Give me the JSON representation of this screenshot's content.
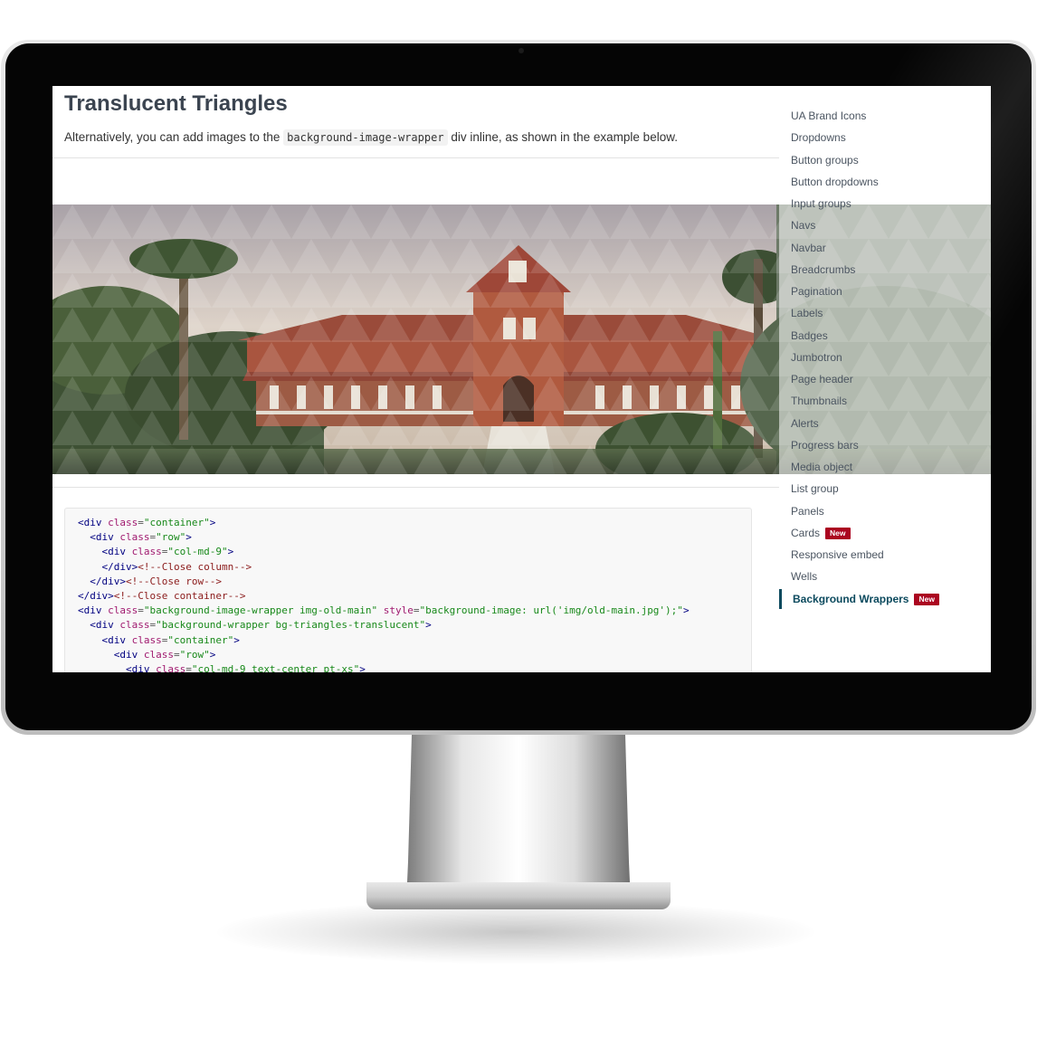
{
  "page": {
    "title": "Translucent Triangles",
    "intro_before": "Alternatively, you can add images to the",
    "intro_code": "background-image-wrapper",
    "intro_after": "div inline, as shown in the example below."
  },
  "code_lines": [
    [
      [
        "tag",
        "<div "
      ],
      [
        "attr",
        "class"
      ],
      [
        "eq",
        "="
      ],
      [
        "str",
        "\"container\""
      ],
      [
        "tag",
        ">"
      ]
    ],
    [
      [
        "tag",
        "  <div "
      ],
      [
        "attr",
        "class"
      ],
      [
        "eq",
        "="
      ],
      [
        "str",
        "\"row\""
      ],
      [
        "tag",
        ">"
      ]
    ],
    [
      [
        "tag",
        "    <div "
      ],
      [
        "attr",
        "class"
      ],
      [
        "eq",
        "="
      ],
      [
        "str",
        "\"col-md-9\""
      ],
      [
        "tag",
        ">"
      ]
    ],
    [
      [
        "tag",
        "    </div>"
      ],
      [
        "com",
        "<!--Close column-->"
      ]
    ],
    [
      [
        "tag",
        "  </div>"
      ],
      [
        "com",
        "<!--Close row-->"
      ]
    ],
    [
      [
        "tag",
        "</div>"
      ],
      [
        "com",
        "<!--Close container-->"
      ]
    ],
    [
      [
        "tag",
        "<div "
      ],
      [
        "attr",
        "class"
      ],
      [
        "eq",
        "="
      ],
      [
        "str",
        "\"background-image-wrapper img-old-main\""
      ],
      [
        "tag",
        " "
      ],
      [
        "attr",
        "style"
      ],
      [
        "eq",
        "="
      ],
      [
        "str",
        "\"background-image: url('img/old-main.jpg');\""
      ],
      [
        "tag",
        ">"
      ]
    ],
    [
      [
        "tag",
        "  <div "
      ],
      [
        "attr",
        "class"
      ],
      [
        "eq",
        "="
      ],
      [
        "str",
        "\"background-wrapper bg-triangles-translucent\""
      ],
      [
        "tag",
        ">"
      ]
    ],
    [
      [
        "tag",
        "    <div "
      ],
      [
        "attr",
        "class"
      ],
      [
        "eq",
        "="
      ],
      [
        "str",
        "\"container\""
      ],
      [
        "tag",
        ">"
      ]
    ],
    [
      [
        "tag",
        "      <div "
      ],
      [
        "attr",
        "class"
      ],
      [
        "eq",
        "="
      ],
      [
        "str",
        "\"row\""
      ],
      [
        "tag",
        ">"
      ]
    ],
    [
      [
        "tag",
        "        <div "
      ],
      [
        "attr",
        "class"
      ],
      [
        "eq",
        "="
      ],
      [
        "str",
        "\"col-md-9 text-center pt-xs\""
      ],
      [
        "tag",
        ">"
      ]
    ]
  ],
  "sidebar": {
    "items": [
      {
        "label": "UA Brand Icons"
      },
      {
        "label": "Dropdowns"
      },
      {
        "label": "Button groups"
      },
      {
        "label": "Button dropdowns"
      },
      {
        "label": "Input groups"
      },
      {
        "label": "Navs"
      },
      {
        "label": "Navbar"
      },
      {
        "label": "Breadcrumbs"
      },
      {
        "label": "Pagination"
      },
      {
        "label": "Labels"
      },
      {
        "label": "Badges"
      },
      {
        "label": "Jumbotron"
      },
      {
        "label": "Page header"
      },
      {
        "label": "Thumbnails"
      },
      {
        "label": "Alerts"
      },
      {
        "label": "Progress bars"
      },
      {
        "label": "Media object"
      },
      {
        "label": "List group"
      },
      {
        "label": "Panels"
      },
      {
        "label": "Cards",
        "badge": "New"
      },
      {
        "label": "Responsive embed"
      },
      {
        "label": "Wells"
      },
      {
        "label": "Background Wrappers",
        "badge": "New",
        "active": true
      }
    ]
  },
  "colors": {
    "accent": "#0c4a5e",
    "badge": "#ab0520",
    "title": "#3b4450"
  }
}
